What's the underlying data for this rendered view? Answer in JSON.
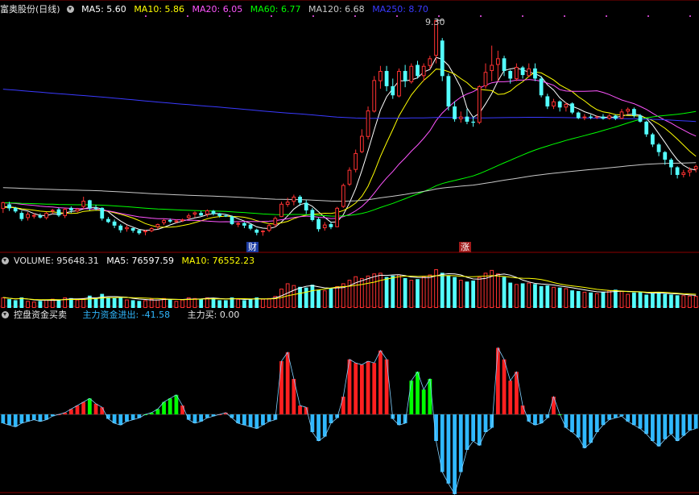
{
  "colors": {
    "up": "#ff3232",
    "down": "#54ffff",
    "grid": "#8b0000",
    "ma5": "#ffffff",
    "ma10": "#ffff00",
    "ma20": "#ff55ff",
    "ma60": "#00ff00",
    "ma120": "#c8c8c8",
    "ma250": "#3a3aff",
    "flow_pos": "#ff2020",
    "flow_neg": "#30b8ff",
    "flow_green": "#00ff00",
    "flow_line": "#80d0ff"
  },
  "header": {
    "stock": "富奥股份(日线)",
    "ma5": "MA5: 5.60",
    "ma10": "MA10: 5.86",
    "ma20": "MA20: 6.05",
    "ma60": "MA60: 6.77",
    "ma120": "MA120: 6.68",
    "ma250": "MA250: 8.70"
  },
  "volume_header": {
    "volume": "VOLUME: 95648.31",
    "ma5": "MA5: 76597.59",
    "ma10": "MA10: 76552.23"
  },
  "flow_header": {
    "name": "控盘资金买卖",
    "main_flow": "主力资金进出: -41.58",
    "main_buy": "主力买: 0.00"
  },
  "annotations": {
    "high_label": "9.30",
    "badge_cai": "财",
    "badge_zhang": "涨"
  },
  "chart_data": [
    {
      "type": "candlestick",
      "title": "富奥股份(日线)",
      "price_range": [
        4.85,
        9.35
      ],
      "high_annotation": 9.3,
      "candles": [
        [
          5.58,
          5.71,
          5.5,
          5.72
        ],
        [
          5.67,
          5.59,
          5.54,
          5.72
        ],
        [
          5.6,
          5.53,
          5.5,
          5.62
        ],
        [
          5.5,
          5.38,
          5.34,
          5.54
        ],
        [
          5.4,
          5.48,
          5.35,
          5.52
        ],
        [
          5.46,
          5.46,
          5.39,
          5.5
        ],
        [
          5.45,
          5.41,
          5.39,
          5.49
        ],
        [
          5.4,
          5.5,
          5.37,
          5.52
        ],
        [
          5.53,
          5.56,
          5.48,
          5.58
        ],
        [
          5.57,
          5.45,
          5.42,
          5.6
        ],
        [
          5.44,
          5.58,
          5.4,
          5.6
        ],
        [
          5.6,
          5.55,
          5.5,
          5.63
        ],
        [
          5.53,
          5.58,
          5.51,
          5.6
        ],
        [
          5.62,
          5.74,
          5.58,
          5.82
        ],
        [
          5.75,
          5.59,
          5.55,
          5.76
        ],
        [
          5.6,
          5.58,
          5.55,
          5.66
        ],
        [
          5.6,
          5.39,
          5.35,
          5.61
        ],
        [
          5.38,
          5.32,
          5.3,
          5.42
        ],
        [
          5.33,
          5.25,
          5.2,
          5.37
        ],
        [
          5.25,
          5.16,
          5.11,
          5.28
        ],
        [
          5.18,
          5.22,
          5.13,
          5.26
        ],
        [
          5.2,
          5.15,
          5.11,
          5.21
        ],
        [
          5.16,
          5.1,
          5.07,
          5.18
        ],
        [
          5.12,
          5.15,
          5.06,
          5.17
        ],
        [
          5.14,
          5.2,
          5.12,
          5.22
        ],
        [
          5.22,
          5.28,
          5.18,
          5.29
        ],
        [
          5.3,
          5.36,
          5.26,
          5.38
        ],
        [
          5.36,
          5.33,
          5.3,
          5.39
        ],
        [
          5.34,
          5.35,
          5.3,
          5.37
        ],
        [
          5.34,
          5.37,
          5.32,
          5.39
        ],
        [
          5.4,
          5.45,
          5.37,
          5.49
        ],
        [
          5.47,
          5.51,
          5.41,
          5.53
        ],
        [
          5.5,
          5.45,
          5.44,
          5.54
        ],
        [
          5.47,
          5.55,
          5.42,
          5.57
        ],
        [
          5.54,
          5.48,
          5.45,
          5.56
        ],
        [
          5.49,
          5.44,
          5.41,
          5.5
        ],
        [
          5.45,
          5.43,
          5.42,
          5.48
        ],
        [
          5.43,
          5.28,
          5.26,
          5.45
        ],
        [
          5.3,
          5.3,
          5.22,
          5.33
        ],
        [
          5.3,
          5.25,
          5.2,
          5.32
        ],
        [
          5.27,
          5.19,
          5.16,
          5.28
        ],
        [
          5.17,
          5.11,
          5.06,
          5.19
        ],
        [
          5.12,
          5.15,
          5.05,
          5.16
        ],
        [
          5.15,
          5.26,
          5.12,
          5.3
        ],
        [
          5.26,
          5.4,
          5.22,
          5.43
        ],
        [
          5.42,
          5.68,
          5.42,
          5.72
        ],
        [
          5.66,
          5.72,
          5.62,
          5.8
        ],
        [
          5.72,
          5.82,
          5.65,
          5.86
        ],
        [
          5.82,
          5.7,
          5.64,
          5.85
        ],
        [
          5.7,
          5.55,
          5.48,
          5.76
        ],
        [
          5.56,
          5.36,
          5.33,
          5.6
        ],
        [
          5.38,
          5.18,
          5.13,
          5.41
        ],
        [
          5.2,
          5.27,
          5.15,
          5.32
        ],
        [
          5.28,
          5.22,
          5.18,
          5.33
        ],
        [
          5.22,
          5.6,
          5.22,
          5.62
        ],
        [
          5.62,
          6.05,
          5.6,
          6.08
        ],
        [
          6.06,
          6.35,
          6.03,
          6.4
        ],
        [
          6.35,
          6.68,
          6.3,
          6.75
        ],
        [
          6.7,
          7.02,
          6.68,
          7.15
        ],
        [
          7.0,
          7.52,
          6.95,
          7.6
        ],
        [
          7.5,
          8.12,
          7.48,
          8.2
        ],
        [
          8.1,
          8.3,
          7.95,
          8.4
        ],
        [
          8.3,
          8.0,
          7.9,
          8.4
        ],
        [
          8.0,
          7.82,
          7.75,
          8.15
        ],
        [
          7.8,
          8.3,
          7.78,
          8.35
        ],
        [
          8.3,
          8.1,
          7.98,
          8.42
        ],
        [
          8.08,
          8.4,
          8.05,
          8.45
        ],
        [
          8.42,
          8.2,
          8.15,
          8.5
        ],
        [
          8.2,
          8.4,
          8.1,
          8.45
        ],
        [
          8.4,
          8.55,
          8.33,
          8.6
        ],
        [
          8.6,
          9.3,
          8.45,
          9.3
        ],
        [
          8.9,
          8.2,
          8.1,
          8.95
        ],
        [
          8.2,
          7.6,
          7.52,
          8.25
        ],
        [
          7.6,
          7.35,
          7.3,
          7.7
        ],
        [
          7.35,
          7.4,
          7.28,
          7.5
        ],
        [
          7.4,
          7.3,
          7.25,
          7.55
        ],
        [
          7.3,
          7.28,
          7.2,
          7.4
        ],
        [
          7.28,
          8.0,
          7.25,
          8.02
        ],
        [
          8.0,
          8.28,
          7.95,
          8.45
        ],
        [
          8.3,
          8.42,
          8.1,
          8.8
        ],
        [
          8.42,
          8.55,
          8.1,
          8.7
        ],
        [
          8.55,
          8.3,
          8.2,
          8.6
        ],
        [
          8.3,
          8.15,
          8.05,
          8.32
        ],
        [
          8.14,
          8.38,
          8.1,
          8.45
        ],
        [
          8.37,
          8.22,
          8.15,
          8.4
        ],
        [
          8.2,
          8.35,
          8.18,
          8.45
        ],
        [
          8.35,
          8.15,
          8.1,
          8.45
        ],
        [
          8.15,
          7.82,
          7.78,
          8.2
        ],
        [
          7.8,
          7.6,
          7.55,
          7.85
        ],
        [
          7.6,
          7.7,
          7.55,
          7.75
        ],
        [
          7.7,
          7.58,
          7.5,
          7.72
        ],
        [
          7.58,
          7.65,
          7.5,
          7.68
        ],
        [
          7.66,
          7.48,
          7.45,
          7.68
        ],
        [
          7.48,
          7.37,
          7.35,
          7.5
        ],
        [
          7.37,
          7.4,
          7.33,
          7.45
        ],
        [
          7.4,
          7.38,
          7.35,
          7.44
        ],
        [
          7.38,
          7.4,
          7.35,
          7.42
        ],
        [
          7.4,
          7.36,
          7.34,
          7.45
        ],
        [
          7.36,
          7.42,
          7.34,
          7.45
        ],
        [
          7.42,
          7.36,
          7.33,
          7.44
        ],
        [
          7.36,
          7.5,
          7.35,
          7.55
        ],
        [
          7.5,
          7.55,
          7.45,
          7.58
        ],
        [
          7.55,
          7.42,
          7.38,
          7.58
        ],
        [
          7.42,
          7.3,
          7.28,
          7.45
        ],
        [
          7.3,
          7.05,
          7.0,
          7.32
        ],
        [
          7.05,
          6.85,
          6.8,
          7.08
        ],
        [
          6.85,
          6.7,
          6.62,
          6.88
        ],
        [
          6.7,
          6.55,
          6.45,
          6.72
        ],
        [
          6.55,
          6.4,
          6.25,
          6.58
        ],
        [
          6.4,
          6.25,
          6.18,
          6.42
        ],
        [
          6.25,
          6.3,
          6.2,
          6.35
        ],
        [
          6.3,
          6.35,
          6.22,
          6.4
        ],
        [
          6.36,
          6.42,
          6.3,
          6.45
        ]
      ],
      "series": [
        {
          "name": "MA5",
          "last": 5.6
        },
        {
          "name": "MA10",
          "last": 5.86
        },
        {
          "name": "MA20",
          "last": 6.05
        },
        {
          "name": "MA60",
          "last": 6.77
        },
        {
          "name": "MA120",
          "last": 6.68
        },
        {
          "name": "MA250",
          "last": 8.7
        }
      ]
    },
    {
      "type": "bar",
      "title": "VOLUME",
      "last_volume": 95648.31,
      "values": [
        30,
        25,
        22,
        30,
        20,
        18,
        20,
        24,
        26,
        22,
        30,
        28,
        24,
        28,
        35,
        28,
        40,
        30,
        28,
        32,
        24,
        22,
        20,
        22,
        26,
        24,
        28,
        24,
        20,
        24,
        30,
        28,
        26,
        30,
        28,
        22,
        22,
        30,
        26,
        22,
        24,
        30,
        26,
        28,
        34,
        55,
        70,
        65,
        60,
        58,
        66,
        52,
        50,
        55,
        62,
        70,
        80,
        90,
        85,
        92,
        98,
        100,
        88,
        92,
        95,
        85,
        80,
        82,
        90,
        95,
        110,
        100,
        92,
        88,
        80,
        75,
        78,
        88,
        100,
        108,
        98,
        88,
        72,
        68,
        70,
        72,
        68,
        62,
        64,
        60,
        58,
        56,
        50,
        48,
        46,
        44,
        42,
        46,
        50,
        52,
        48,
        40,
        44,
        46,
        38,
        42,
        44,
        40,
        38,
        36,
        36,
        35,
        34
      ],
      "series": [
        {
          "name": "MA5",
          "last": 76597.59
        },
        {
          "name": "MA10",
          "last": 76552.23
        }
      ]
    },
    {
      "type": "bar",
      "title": "控盘资金买卖",
      "values": [
        -10,
        -12,
        -14,
        -10,
        -8,
        -6,
        -8,
        -6,
        -2,
        0,
        2,
        6,
        10,
        14,
        18,
        12,
        8,
        -5,
        -10,
        -12,
        -8,
        -6,
        -4,
        0,
        2,
        6,
        14,
        18,
        22,
        10,
        -6,
        -10,
        -8,
        -4,
        -2,
        0,
        2,
        -4,
        -10,
        -12,
        -14,
        -16,
        -12,
        -8,
        -6,
        60,
        70,
        40,
        10,
        8,
        -20,
        -30,
        -25,
        -10,
        -4,
        20,
        62,
        58,
        56,
        60,
        58,
        72,
        62,
        -5,
        -12,
        -10,
        38,
        48,
        28,
        40,
        -30,
        -65,
        -78,
        -90,
        -65,
        -40,
        -30,
        -35,
        -20,
        -15,
        75,
        62,
        38,
        48,
        10,
        -8,
        -12,
        -10,
        -4,
        20,
        0,
        -15,
        -20,
        -26,
        -38,
        -32,
        -20,
        -12,
        -6,
        -4,
        -2,
        -8,
        -12,
        -16,
        -22,
        -30,
        -36,
        -28,
        -22,
        -30,
        -24,
        -18,
        -16
      ],
      "green": [
        14,
        20,
        21,
        22,
        23,
        24,
        25,
        26,
        27,
        28,
        54,
        65,
        66,
        67,
        68,
        69,
        85,
        90,
        91
      ]
    }
  ]
}
